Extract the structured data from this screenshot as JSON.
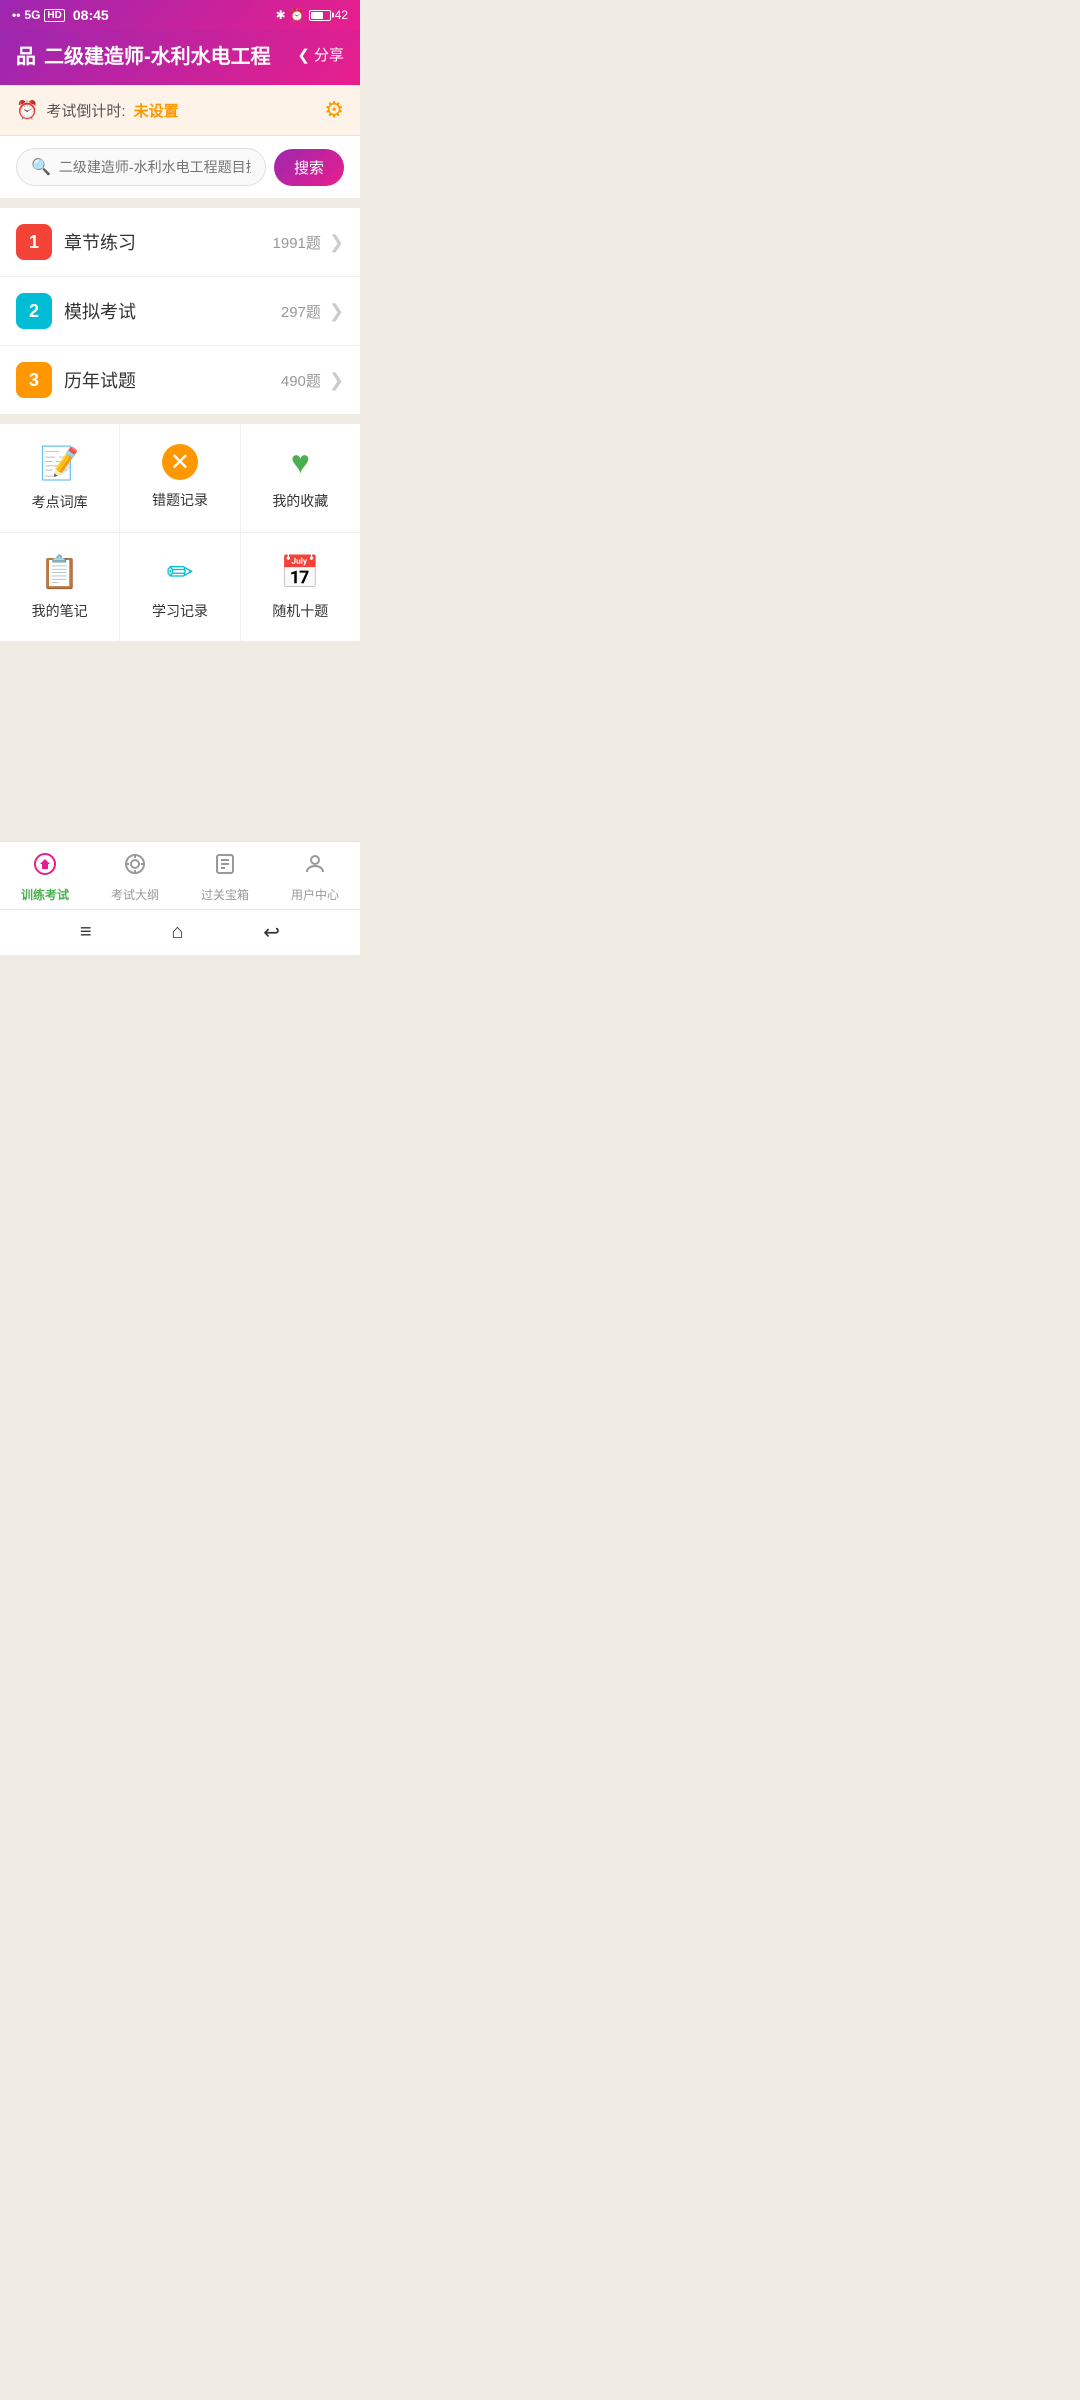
{
  "statusBar": {
    "signal": "5G",
    "hdLabel": "HD",
    "time": "08:45",
    "batteryLevel": 42
  },
  "header": {
    "icon": "品",
    "title": "二级建造师-水利水电工程",
    "shareLabel": "< 分享"
  },
  "countdown": {
    "icon": "⏰",
    "label": "考试倒计时:",
    "value": "未设置",
    "settingsIcon": "⚙"
  },
  "search": {
    "placeholder": "二级建造师-水利水电工程题目搜索",
    "buttonLabel": "搜索"
  },
  "menuItems": [
    {
      "num": "1",
      "label": "章节练习",
      "count": "1991题",
      "colorClass": "num-red"
    },
    {
      "num": "2",
      "label": "模拟考试",
      "count": "297题",
      "colorClass": "num-cyan"
    },
    {
      "num": "3",
      "label": "历年试题",
      "count": "490题",
      "colorClass": "num-orange"
    }
  ],
  "gridItems": [
    [
      {
        "icon": "✏️",
        "label": "考点词库",
        "color": "#f44336"
      },
      {
        "icon": "❌",
        "label": "错题记录",
        "color": "#ff9800"
      },
      {
        "icon": "💚",
        "label": "我的收藏",
        "color": "#4caf50"
      }
    ],
    [
      {
        "icon": "☰",
        "label": "我的笔记",
        "color": "#4caf50"
      },
      {
        "icon": "✏",
        "label": "学习记录",
        "color": "#00bcd4"
      },
      {
        "icon": "🔭",
        "label": "随机十题",
        "color": "#ff9800"
      }
    ]
  ],
  "bottomNav": [
    {
      "label": "训练考试",
      "active": true
    },
    {
      "label": "考试大纲",
      "active": false
    },
    {
      "label": "过关宝箱",
      "active": false
    },
    {
      "label": "用户中心",
      "active": false
    }
  ],
  "sysNav": {
    "menu": "≡",
    "home": "⌂",
    "back": "↩"
  }
}
